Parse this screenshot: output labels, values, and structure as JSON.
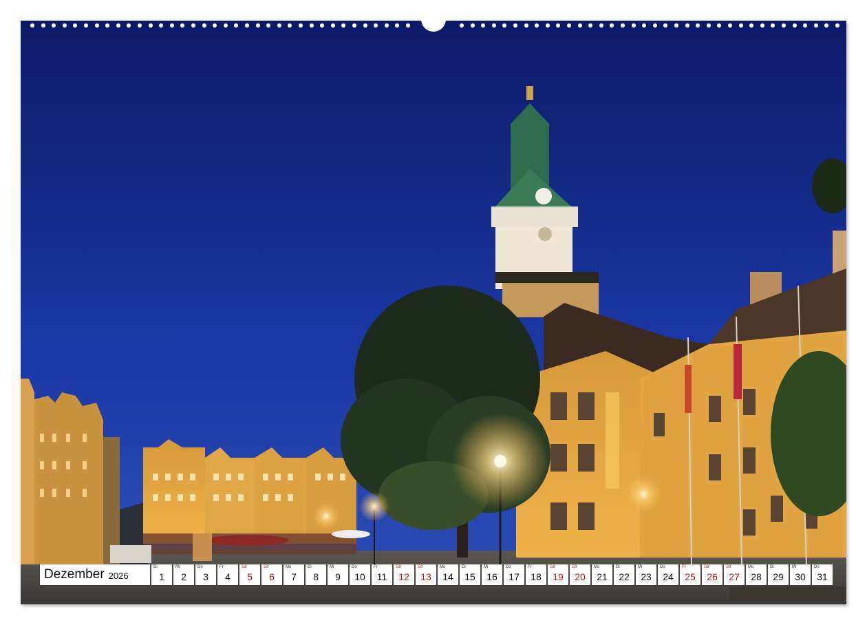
{
  "calendar": {
    "month": "Dezember",
    "year": "2026",
    "days": [
      {
        "dow": "Di",
        "num": "1",
        "weekend": false
      },
      {
        "dow": "Mi",
        "num": "2",
        "weekend": false
      },
      {
        "dow": "Do",
        "num": "3",
        "weekend": false
      },
      {
        "dow": "Fr",
        "num": "4",
        "weekend": false
      },
      {
        "dow": "Sa",
        "num": "5",
        "weekend": true
      },
      {
        "dow": "So",
        "num": "6",
        "weekend": true
      },
      {
        "dow": "Mo",
        "num": "7",
        "weekend": false
      },
      {
        "dow": "Di",
        "num": "8",
        "weekend": false
      },
      {
        "dow": "Mi",
        "num": "9",
        "weekend": false
      },
      {
        "dow": "Do",
        "num": "10",
        "weekend": false
      },
      {
        "dow": "Fr",
        "num": "11",
        "weekend": false
      },
      {
        "dow": "Sa",
        "num": "12",
        "weekend": true
      },
      {
        "dow": "So",
        "num": "13",
        "weekend": true
      },
      {
        "dow": "Mo",
        "num": "14",
        "weekend": false
      },
      {
        "dow": "Di",
        "num": "15",
        "weekend": false
      },
      {
        "dow": "Mi",
        "num": "16",
        "weekend": false
      },
      {
        "dow": "Do",
        "num": "17",
        "weekend": false
      },
      {
        "dow": "Fr",
        "num": "18",
        "weekend": false
      },
      {
        "dow": "Sa",
        "num": "19",
        "weekend": true
      },
      {
        "dow": "So",
        "num": "20",
        "weekend": true
      },
      {
        "dow": "Mo",
        "num": "21",
        "weekend": false
      },
      {
        "dow": "Di",
        "num": "22",
        "weekend": false
      },
      {
        "dow": "Mi",
        "num": "23",
        "weekend": false
      },
      {
        "dow": "Do",
        "num": "24",
        "weekend": false
      },
      {
        "dow": "Fr",
        "num": "25",
        "weekend": true
      },
      {
        "dow": "Sa",
        "num": "26",
        "weekend": true
      },
      {
        "dow": "So",
        "num": "27",
        "weekend": true
      },
      {
        "dow": "Mo",
        "num": "28",
        "weekend": false
      },
      {
        "dow": "Di",
        "num": "29",
        "weekend": false
      },
      {
        "dow": "Mi",
        "num": "30",
        "weekend": false
      },
      {
        "dow": "Do",
        "num": "31",
        "weekend": false
      }
    ]
  },
  "photo": {
    "icon": "town-hall-night-photo",
    "colors": {
      "sky_top": "#0e1d6e",
      "sky_bottom": "#1b3aa8",
      "facade": "#e8a640",
      "lamp": "#fff3c4"
    }
  },
  "colors": {
    "weekend": "#c0161a",
    "cell_bg": "#ffffff"
  }
}
